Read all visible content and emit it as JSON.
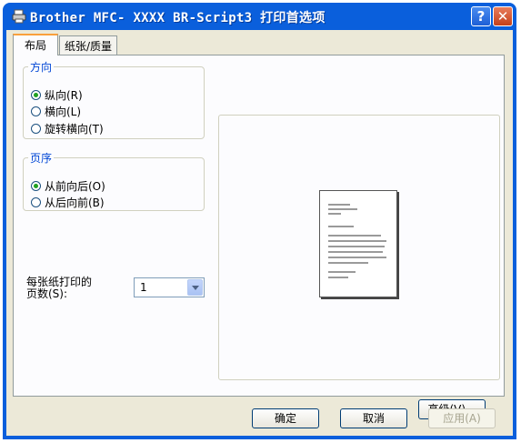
{
  "window": {
    "title": "Brother MFC- XXXX BR-Script3 打印首选项",
    "help_glyph": "?",
    "close_glyph": "✕"
  },
  "tabs": [
    {
      "label": "布局",
      "active": true
    },
    {
      "label": "纸张/质量",
      "active": false
    }
  ],
  "orientation": {
    "legend": "方向",
    "options": [
      {
        "label": "纵向(R)",
        "checked": true
      },
      {
        "label": "横向(L)",
        "checked": false
      },
      {
        "label": "旋转横向(T)",
        "checked": false
      }
    ]
  },
  "page_order": {
    "legend": "页序",
    "options": [
      {
        "label": "从前向后(O)",
        "checked": true
      },
      {
        "label": "从后向前(B)",
        "checked": false
      }
    ]
  },
  "pages_per_sheet": {
    "label_line1": "每张纸打印的",
    "label_line2": "页数(S):",
    "value": "1"
  },
  "buttons": {
    "advanced": "高级(V)...",
    "ok": "确定",
    "cancel": "取消",
    "apply": "应用(A)"
  },
  "colors": {
    "titlebar": "#0a5fdc",
    "dialog_bg": "#ece9d8",
    "group_legend": "#0046d5",
    "radio_dot": "#21a121"
  }
}
